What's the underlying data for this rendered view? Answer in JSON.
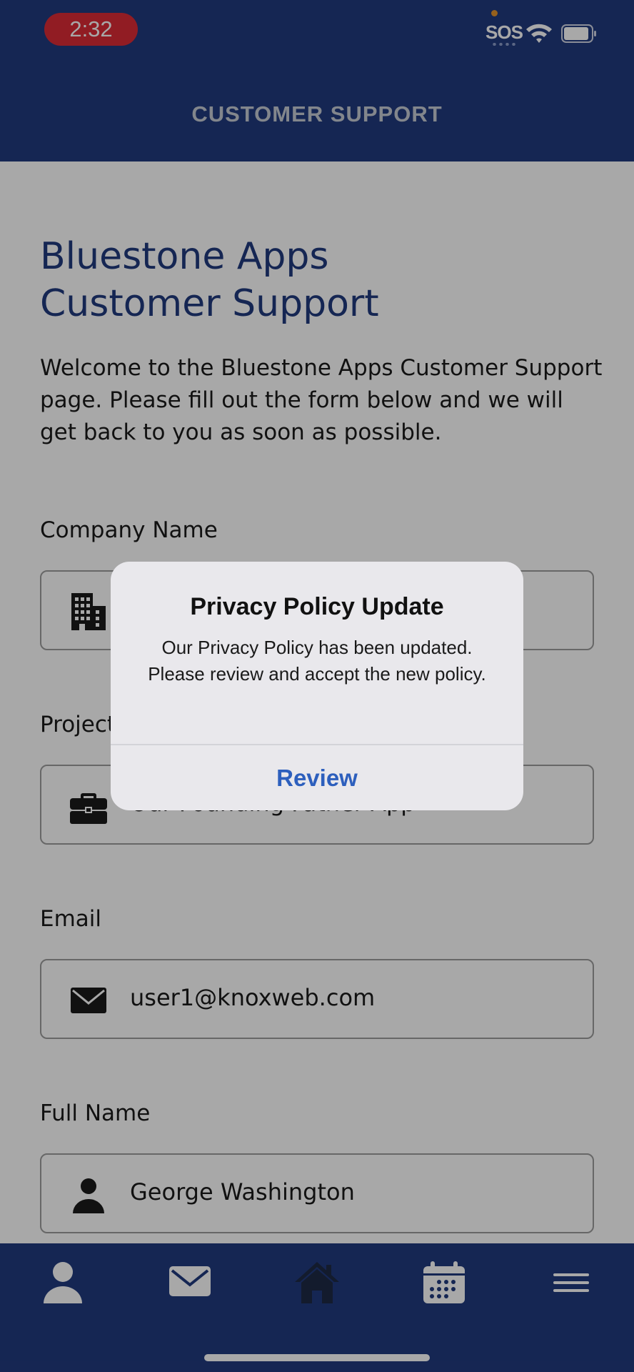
{
  "status_bar": {
    "time": "2:32",
    "sos": "SOS",
    "accent_color": "#dd2b36"
  },
  "nav": {
    "title": "CUSTOMER SUPPORT",
    "bar_color": "#213a7e"
  },
  "page": {
    "heading_line1": "Bluestone Apps",
    "heading_line2": "Customer Support",
    "intro": "Welcome to the Bluestone Apps Customer Support page. Please fill out the form below and we will get back to you as soon as possible."
  },
  "form": {
    "company": {
      "label": "Company Name",
      "value": "",
      "icon": "building-icon"
    },
    "project": {
      "label": "Project",
      "value": "Our Founding Father App",
      "icon": "briefcase-icon"
    },
    "email": {
      "label": "Email",
      "value": "user1@knoxweb.com",
      "icon": "envelope-icon"
    },
    "fullname": {
      "label": "Full Name",
      "value": "George Washington",
      "icon": "person-icon"
    }
  },
  "tab_bar": {
    "items": [
      {
        "name": "profile",
        "icon": "person-icon"
      },
      {
        "name": "messages",
        "icon": "envelope-icon"
      },
      {
        "name": "home",
        "icon": "home-icon"
      },
      {
        "name": "calendar",
        "icon": "calendar-icon"
      },
      {
        "name": "menu",
        "icon": "menu-icon"
      }
    ]
  },
  "alert": {
    "title": "Privacy Policy Update",
    "message": "Our Privacy Policy has been updated. Please review and accept the new policy.",
    "button": "Review",
    "button_color": "#2d5fbd"
  }
}
